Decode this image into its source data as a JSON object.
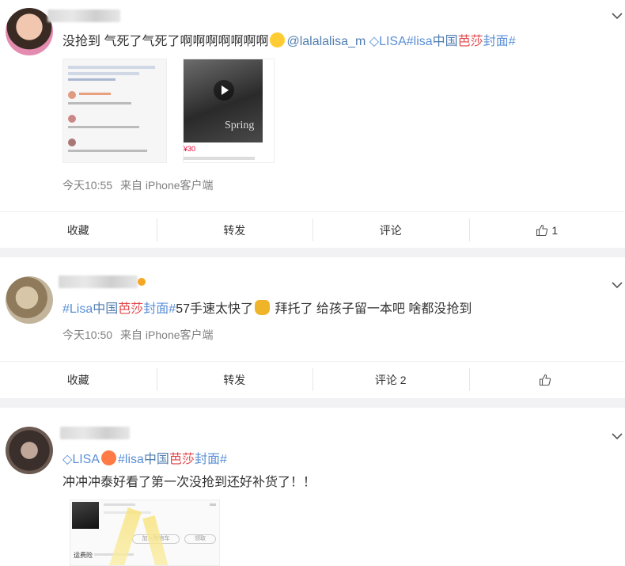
{
  "posts": [
    {
      "text": "没抢到 气死了气死了啊啊啊啊啊啊啊",
      "mention": "@lalalalisa_m",
      "tag_lisa": "LISA",
      "tag_full_a": "#lisa",
      "tag_full_b": "中国",
      "tag_full_c": "芭莎",
      "tag_full_d": "封面#",
      "time": "今天10:55",
      "source": "来自 iPhone客户端",
      "actions": {
        "collect": "收藏",
        "repost": "转发",
        "comment": "评论",
        "like_count": "1"
      },
      "image_right_price": "¥30",
      "image_right_word": "Spring"
    },
    {
      "tag_a": "#Lisa",
      "tag_b": "中国",
      "tag_c": "芭莎",
      "tag_d": "封面#",
      "text": "57手速太快了",
      "text2": " 拜托了 给孩子留一本吧 啥都没抢到",
      "time": "今天10:50",
      "source": "来自 iPhone客户端",
      "actions": {
        "collect": "收藏",
        "repost": "转发",
        "comment": "评论 2",
        "like_count": ""
      }
    },
    {
      "tag_lisa": "LISA",
      "tag_a": "#lisa",
      "tag_b": "中国",
      "tag_c": "芭莎",
      "tag_d": "封面#",
      "text": "冲冲冲泰好看了第一次没抢到还好补货了！！",
      "image_row1": "加入购物车",
      "image_row2": "领取",
      "image_label": "运费险"
    }
  ],
  "colors": {
    "link": "#507daf",
    "accent": "#eb7350",
    "muted": "#808080"
  }
}
